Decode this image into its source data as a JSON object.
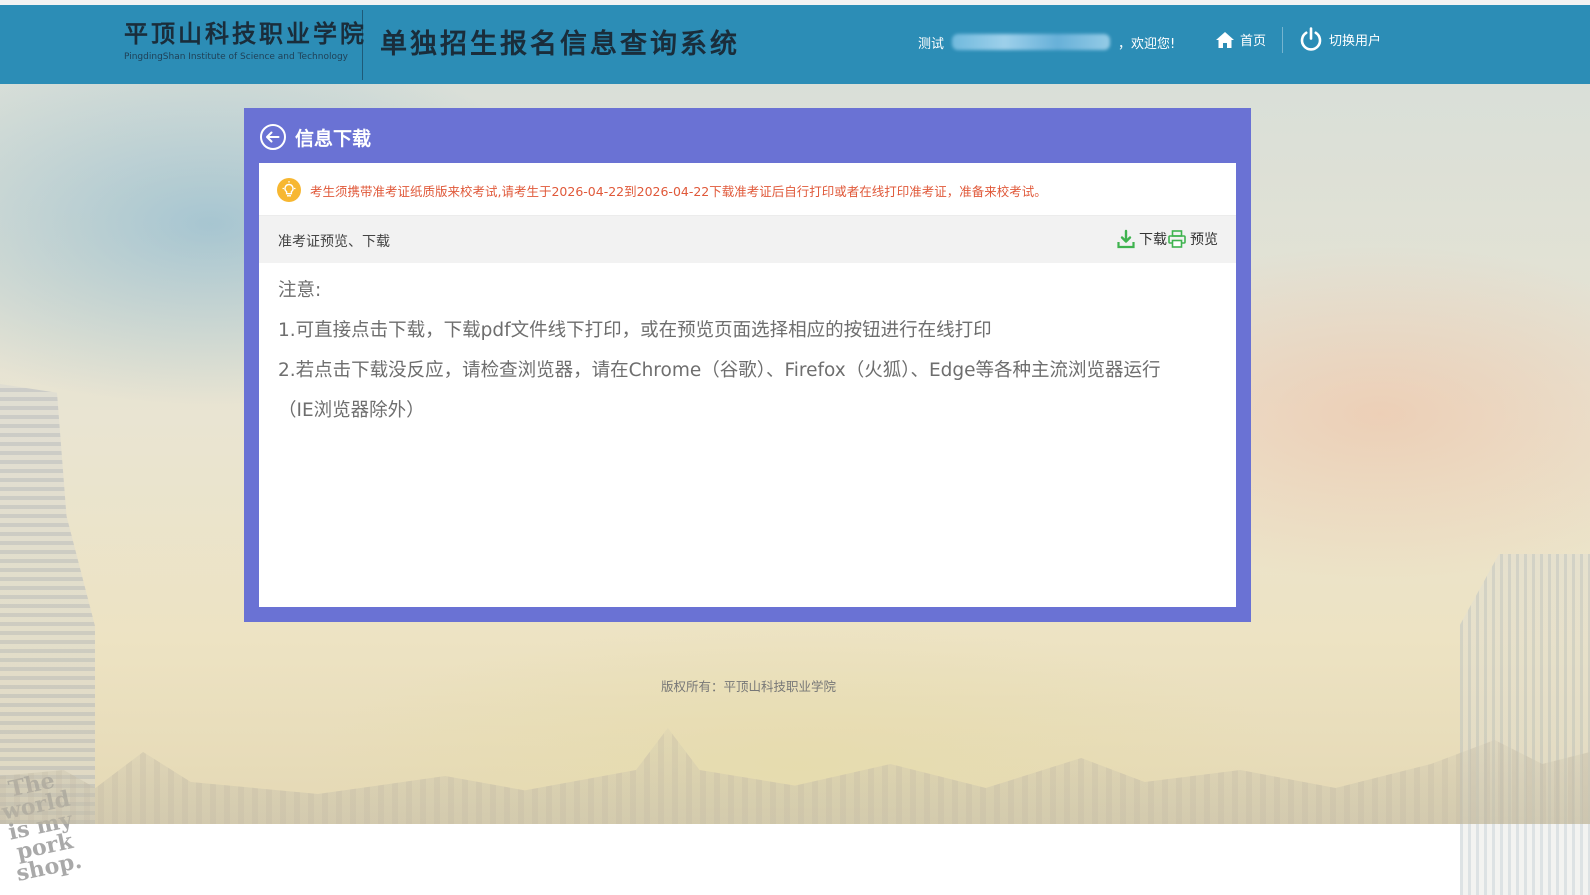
{
  "header": {
    "school_name": "平顶山科技职业学院",
    "school_name_en": "PingdingShan Institute of Science and Technology",
    "system_title": "单独招生报名信息查询系统",
    "user_prefix": "测试",
    "welcome": "，欢迎您!",
    "nav": {
      "home_label": "首页",
      "home_icon": "home-icon",
      "switch_label": "切换用户",
      "switch_icon": "power-icon"
    },
    "bar_color": "#2c8db6"
  },
  "panel": {
    "title": "信息下载",
    "back_icon": "back-arrow-icon",
    "frame_color": "#6a72d4",
    "notice": {
      "icon": "lightbulb-icon",
      "text": "考生须携带准考证纸质版来校考试,请考生于2026-04-22到2026-04-22下载准考证后自行打印或者在线打印准考证，准备来校考试。",
      "color": "#e0593a"
    },
    "row": {
      "label": "准考证预览、下载",
      "download_label": "下载",
      "download_icon": "download-icon",
      "preview_label": "预览",
      "preview_icon": "printer-icon"
    },
    "notes": {
      "heading": "注意:",
      "items": [
        "1.可直接点击下载，下载pdf文件线下打印，或在预览页面选择相应的按钮进行在线打印",
        "2.若点击下载没反应，请检查浏览器，请在Chrome（谷歌）、Firefox（火狐）、Edge等各种主流浏览器运行",
        "（IE浏览器除外）"
      ]
    }
  },
  "background": {
    "poster_text": "The world is my pork shop."
  },
  "footer": {
    "copyright": "版权所有：平顶山科技职业学院"
  }
}
